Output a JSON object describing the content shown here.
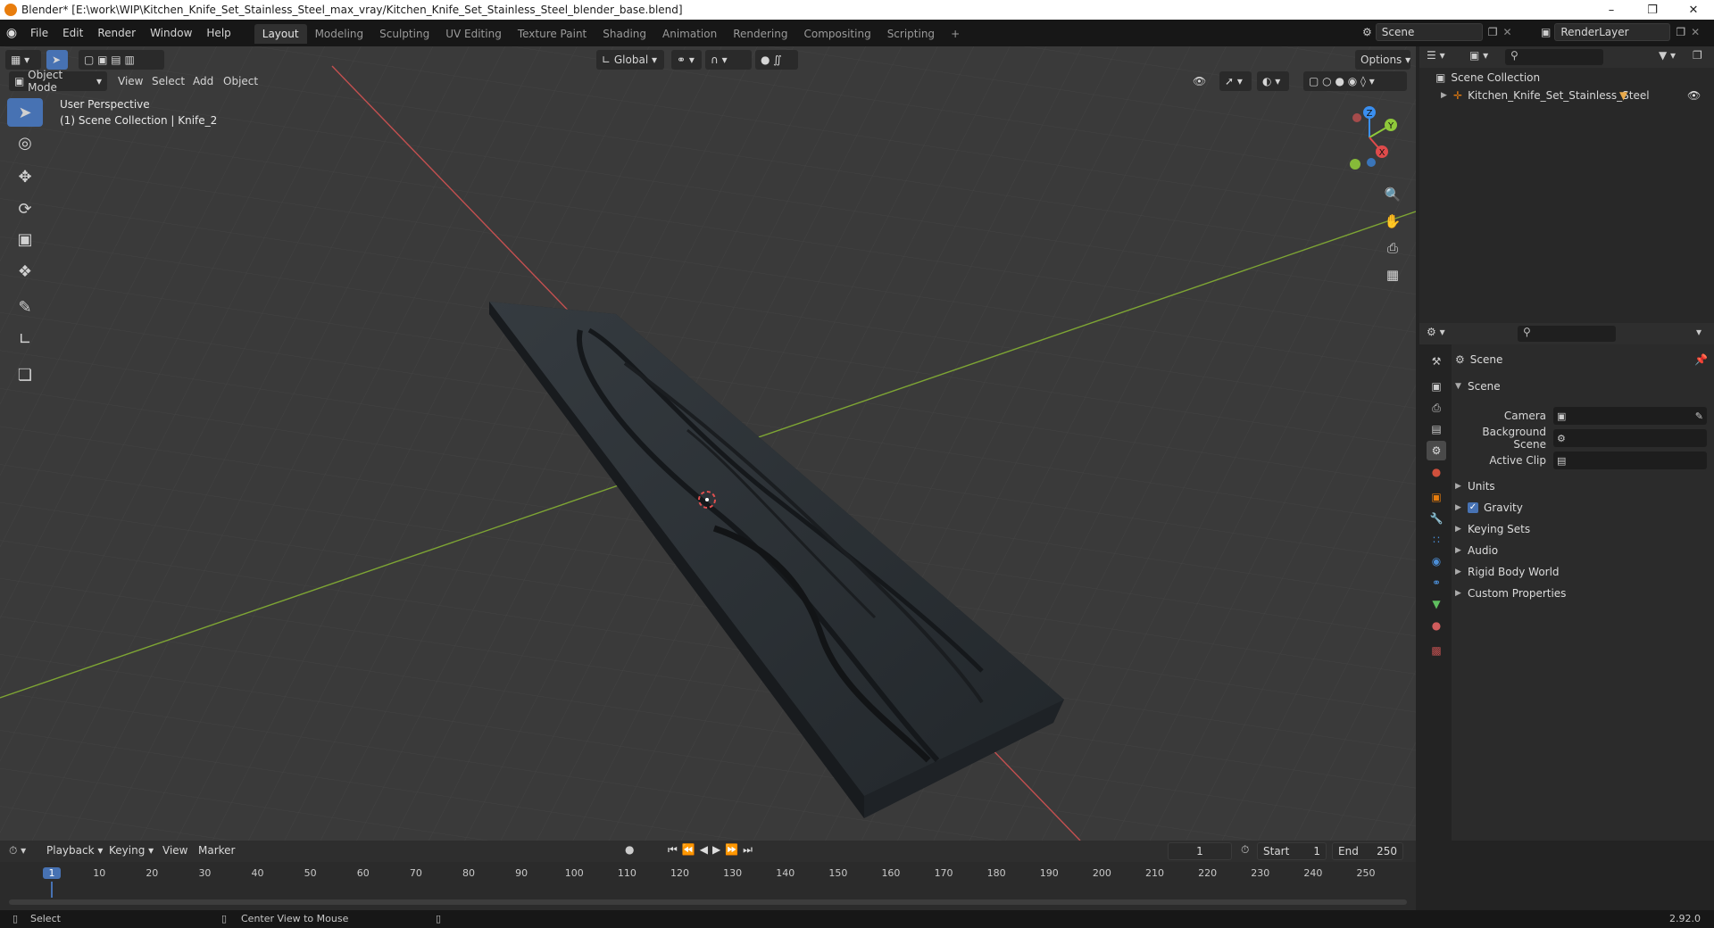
{
  "window": {
    "title": "Blender* [E:\\work\\WIP\\Kitchen_Knife_Set_Stainless_Steel_max_vray/Kitchen_Knife_Set_Stainless_Steel_blender_base.blend]",
    "min_icon": "minimize-icon",
    "max_icon": "restore-icon",
    "close_icon": "close-icon"
  },
  "menu": [
    "File",
    "Edit",
    "Render",
    "Window",
    "Help"
  ],
  "workspaces": [
    {
      "label": "Layout",
      "active": true
    },
    {
      "label": "Modeling"
    },
    {
      "label": "Sculpting"
    },
    {
      "label": "UV Editing"
    },
    {
      "label": "Texture Paint"
    },
    {
      "label": "Shading"
    },
    {
      "label": "Animation"
    },
    {
      "label": "Rendering"
    },
    {
      "label": "Compositing"
    },
    {
      "label": "Scripting"
    }
  ],
  "add_workspace": "+",
  "scene_field": "Scene",
  "renderlayer_field": "RenderLayer",
  "viewport": {
    "mode": "Object Mode",
    "menus": [
      "View",
      "Select",
      "Add",
      "Object"
    ],
    "transform_orientation": "Global",
    "options_label": "Options",
    "overlay_line1": "User Perspective",
    "overlay_line2": "(1) Scene Collection | Knife_2",
    "gizmo_axes": [
      "X",
      "Y",
      "Z"
    ],
    "colors": {
      "x_axis": "#e04b4b",
      "y_axis": "#8fc93a",
      "z_axis": "#3a8ff0",
      "grid": "#454545",
      "object": "#2c3136"
    }
  },
  "outliner": {
    "root": "Scene Collection",
    "items": [
      "Kitchen_Knife_Set_Stainless_Steel"
    ]
  },
  "properties": {
    "context": "Scene",
    "panel": "Scene",
    "fields": [
      {
        "label": "Camera",
        "value": ""
      },
      {
        "label": "Background Scene",
        "value": ""
      },
      {
        "label": "Active Clip",
        "value": ""
      }
    ],
    "subpanels": [
      "Units",
      "Gravity",
      "Keying Sets",
      "Audio",
      "Rigid Body World",
      "Custom Properties"
    ],
    "gravity_checked": true
  },
  "timeline": {
    "menus": [
      "Playback",
      "Keying",
      "View",
      "Marker"
    ],
    "current_frame": "1",
    "start_label": "Start",
    "start_value": "1",
    "end_label": "End",
    "end_value": "250",
    "ticks": [
      "1",
      "10",
      "20",
      "30",
      "40",
      "50",
      "60",
      "70",
      "80",
      "90",
      "100",
      "110",
      "120",
      "130",
      "140",
      "150",
      "160",
      "170",
      "180",
      "190",
      "200",
      "210",
      "220",
      "230",
      "240",
      "250"
    ]
  },
  "status": {
    "left": "Select",
    "middle": "Center View to Mouse",
    "version": "2.92.0"
  }
}
